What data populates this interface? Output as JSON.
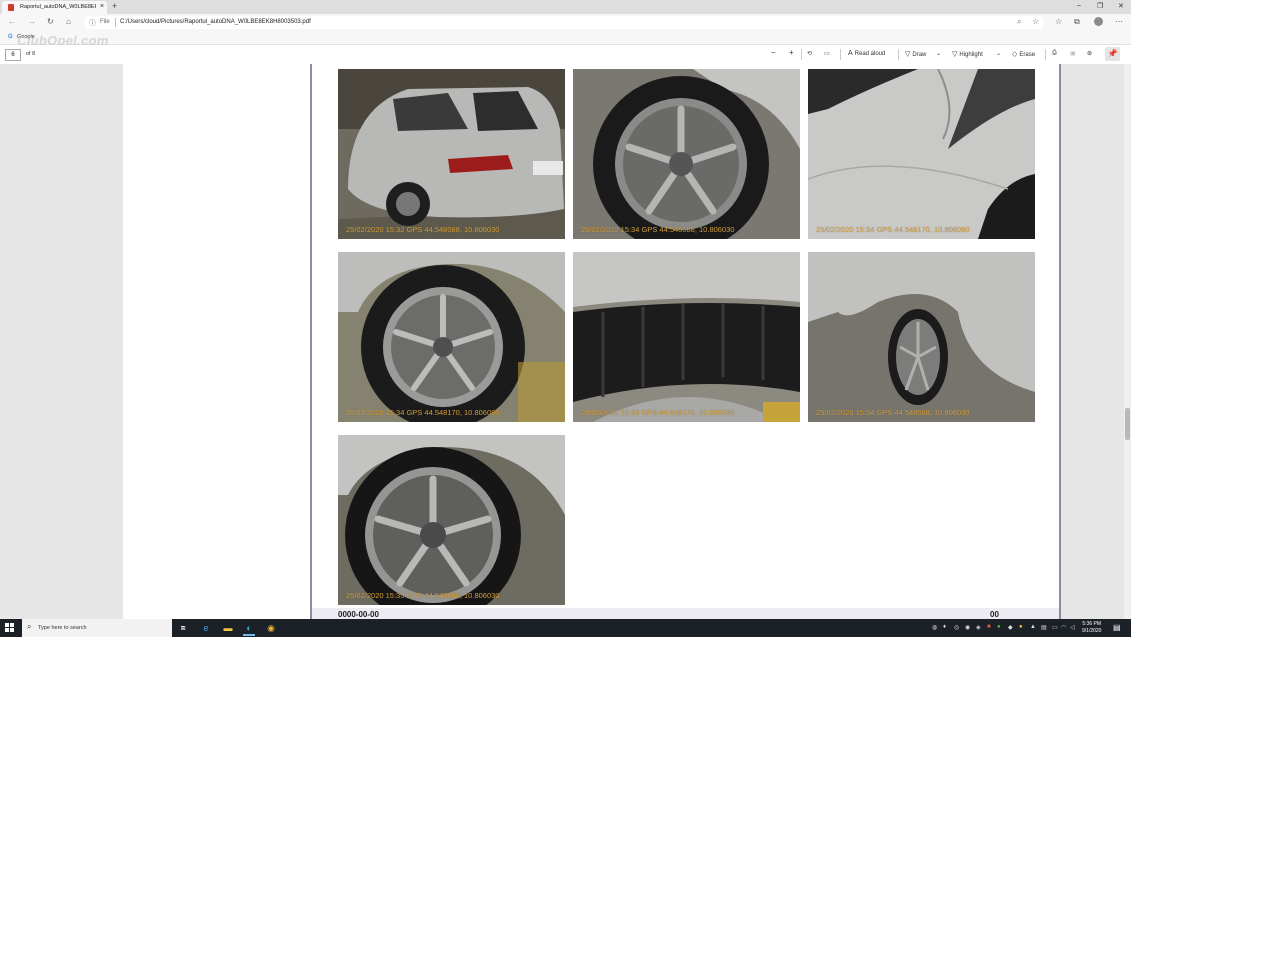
{
  "browser": {
    "tab_title": "Raportul_autoDNA_W0LBE8EK8H",
    "tab_close": "×",
    "new_tab": "+",
    "window_minimize": "–",
    "window_restore": "❐",
    "window_close": "✕",
    "address_file_label": "File",
    "url": "C:/Users/cloud/Pictures/Raportul_autoDNA_W0LBE8EK8H8003503.pdf",
    "favorites": [
      {
        "label": "Google",
        "icon": "google-icon"
      }
    ],
    "watermark": "ClubOpel.com"
  },
  "pdf_toolbar": {
    "page_number": "6",
    "page_of": "of 8",
    "zoom_out": "−",
    "zoom_in": "+",
    "read_aloud": "Read aloud",
    "draw": "Draw",
    "highlight": "Highlight",
    "erase": "Erase"
  },
  "photos": [
    {
      "stamp": "25/02/2020 15:32    GPS 44.548088, 10.806030",
      "subject": "rear-car"
    },
    {
      "stamp": "25/02/2020 15:34    GPS 44.548088, 10.806030",
      "subject": "wheel"
    },
    {
      "stamp": "25/02/2020 15:34    GPS 44.548170, 10.806080",
      "subject": "panel"
    },
    {
      "stamp": "25/02/2020 15:34    GPS 44.548170, 10.806080",
      "subject": "wheel"
    },
    {
      "stamp": "25/02/2020 15:34    GPS 44.548170, 10.806080",
      "subject": "tire"
    },
    {
      "stamp": "25/02/2020 15:34    GPS 44.548088, 10.806030",
      "subject": "side-wheel"
    },
    {
      "stamp": "25/02/2020 15:35    GPS 44.548088, 10.806030",
      "subject": "wheel-close"
    }
  ],
  "page_footer": {
    "left": "0000-00-00",
    "right": "00"
  },
  "taskbar": {
    "search_placeholder": "Type here to search",
    "time": "5:36 PM",
    "date": "9/1/2020"
  },
  "colors": {
    "stamp": "#d4a03a",
    "taskbar": "#1c2027",
    "page_border": "#888ea0"
  }
}
